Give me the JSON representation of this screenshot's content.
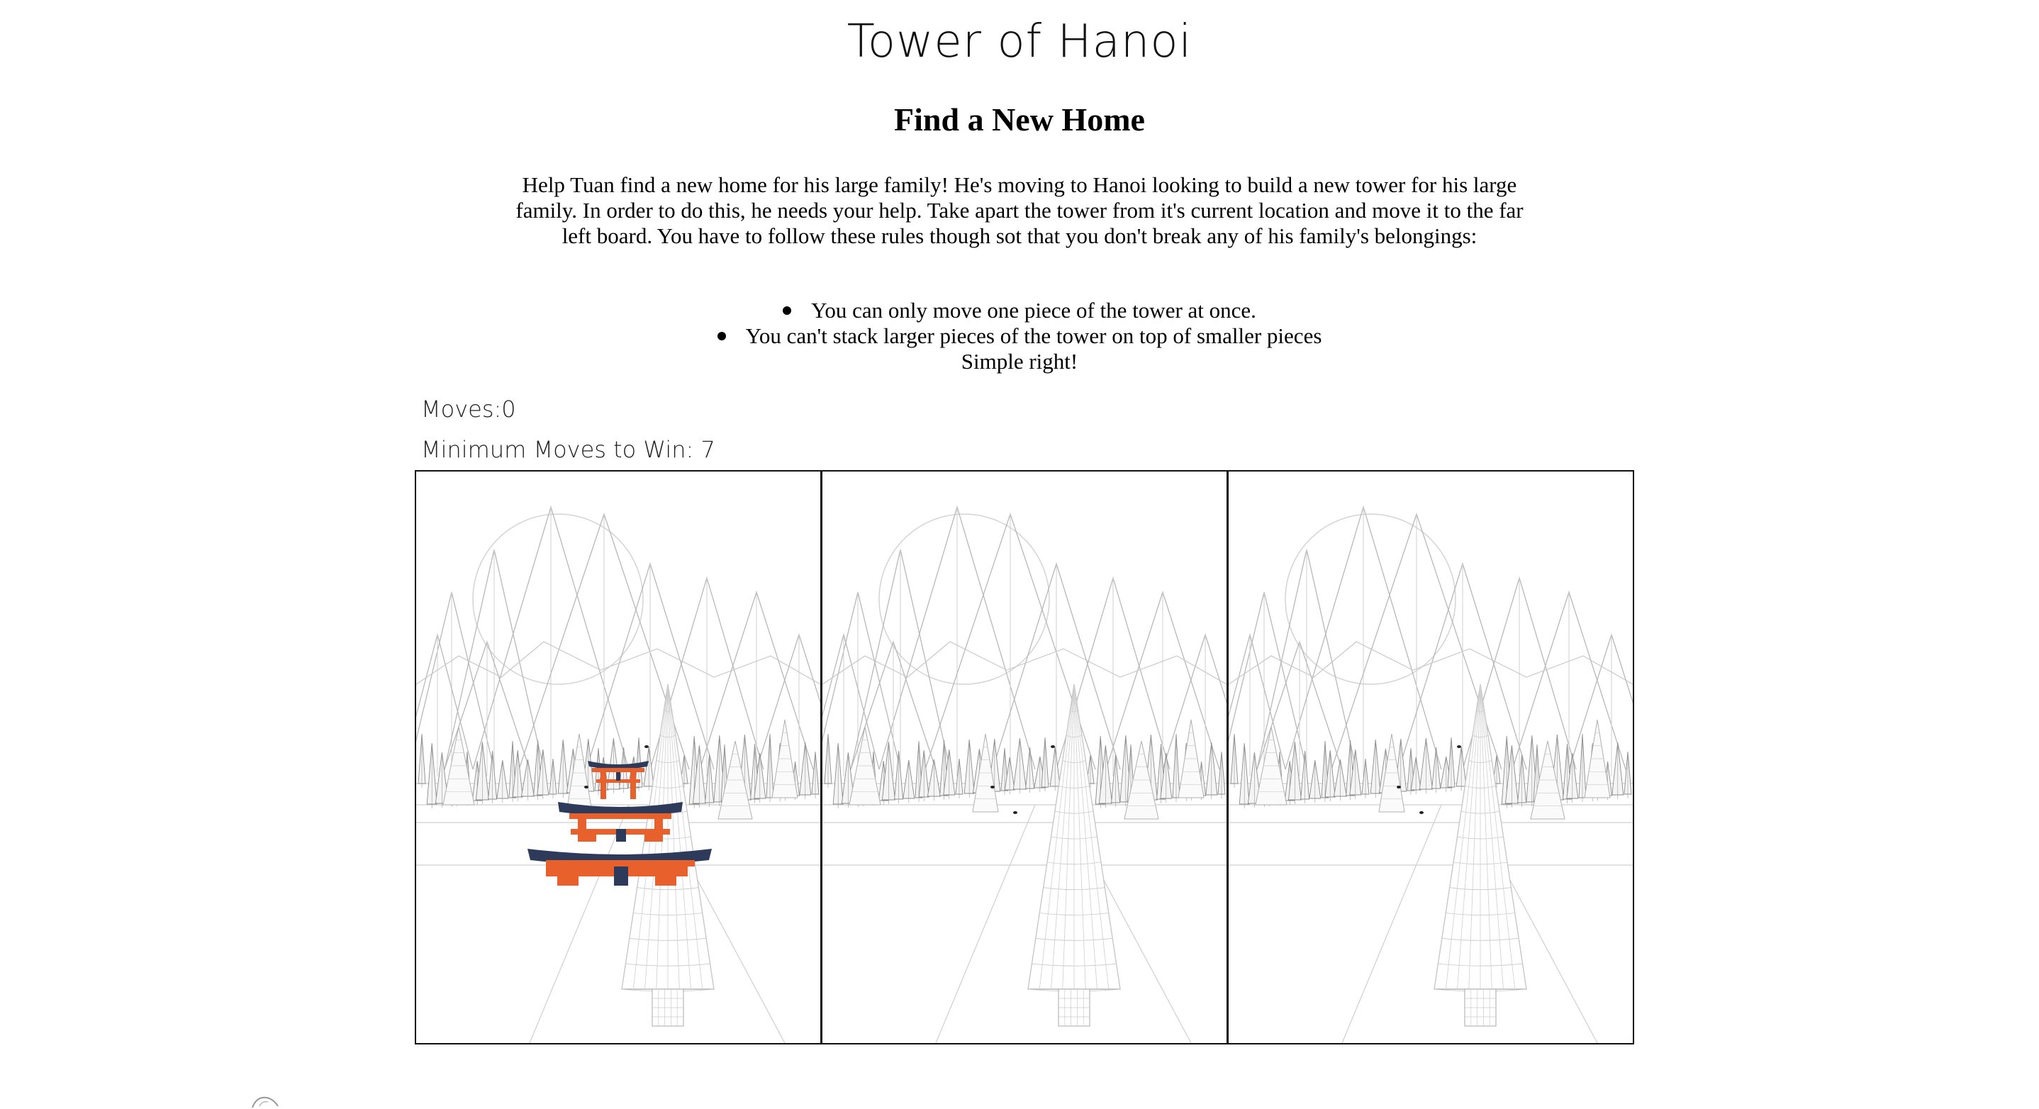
{
  "header": {
    "title": "Tower of Hanoi",
    "subtitle": "Find a New Home"
  },
  "instructions": {
    "intro": "Help Tuan find a new home for his large family! He's moving to Hanoi looking to build a new tower for his large family. In order to do this, he needs your help. Take apart the tower from it's current location and move it to the far left board. You have to follow these rules though sot that you don't break any of his family's belongings:",
    "rules": [
      "You can only move one piece of the tower at once.",
      "You can't stack larger pieces of the tower on top of smaller pieces"
    ],
    "outro": "Simple right!"
  },
  "stats": {
    "moves_label": "Moves:",
    "moves_value": "0",
    "min_moves_label": "Minimum Moves to Win:",
    "min_moves_value": "7"
  },
  "game": {
    "boards": [
      "left-board",
      "middle-board",
      "right-board"
    ],
    "disks_on_left_board": [
      "small-torii-piece",
      "medium-torii-piece",
      "large-torii-piece"
    ],
    "colors": {
      "roof": "#2e3a5a",
      "pillar": "#e8612c",
      "sketch": "#b8b8b8",
      "border": "#111111"
    }
  }
}
